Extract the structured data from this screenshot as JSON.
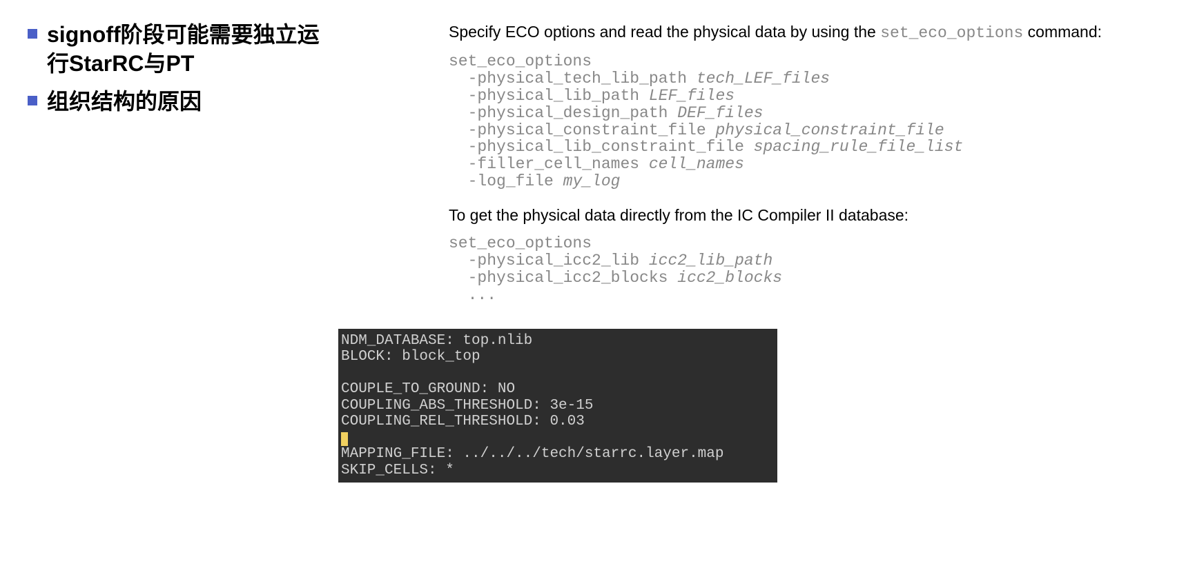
{
  "left": {
    "bullets": [
      "signoff阶段可能需要独立运行StarRC与PT",
      "组织结构的原因"
    ]
  },
  "right": {
    "para1_prefix": "Specify ECO options and read the physical data by using the ",
    "para1_code": "set_eco_options",
    "para1_suffix": " command:",
    "code1_line1": "set_eco_options",
    "code1_line2a": "  -physical_tech_lib_path ",
    "code1_line2b": "tech_LEF_files",
    "code1_line3a": "  -physical_lib_path ",
    "code1_line3b": "LEF_files",
    "code1_line4a": "  -physical_design_path ",
    "code1_line4b": "DEF_files",
    "code1_line5a": "  -physical_constraint_file ",
    "code1_line5b": "physical_constraint_file",
    "code1_line6a": "  -physical_lib_constraint_file ",
    "code1_line6b": "spacing_rule_file_list",
    "code1_line7a": "  -filler_cell_names ",
    "code1_line7b": "cell_names",
    "code1_line8a": "  -log_file ",
    "code1_line8b": "my_log",
    "para2": "To get the physical data directly from the IC Compiler II database:",
    "code2_line1": "set_eco_options",
    "code2_line2a": "  -physical_icc2_lib ",
    "code2_line2b": "icc2_lib_path",
    "code2_line3a": "  -physical_icc2_blocks ",
    "code2_line3b": "icc2_blocks",
    "code2_line4": "  ...",
    "terminal_line1": "NDM_DATABASE: top.nlib",
    "terminal_line2": "BLOCK: block_top",
    "terminal_line3": "",
    "terminal_line4": "COUPLE_TO_GROUND: NO",
    "terminal_line5": "COUPLING_ABS_THRESHOLD: 3e-15",
    "terminal_line6": "COUPLING_REL_THRESHOLD: 0.03",
    "terminal_line7": "MAPPING_FILE: ../../../tech/starrc.layer.map",
    "terminal_line8": "SKIP_CELLS: *"
  }
}
